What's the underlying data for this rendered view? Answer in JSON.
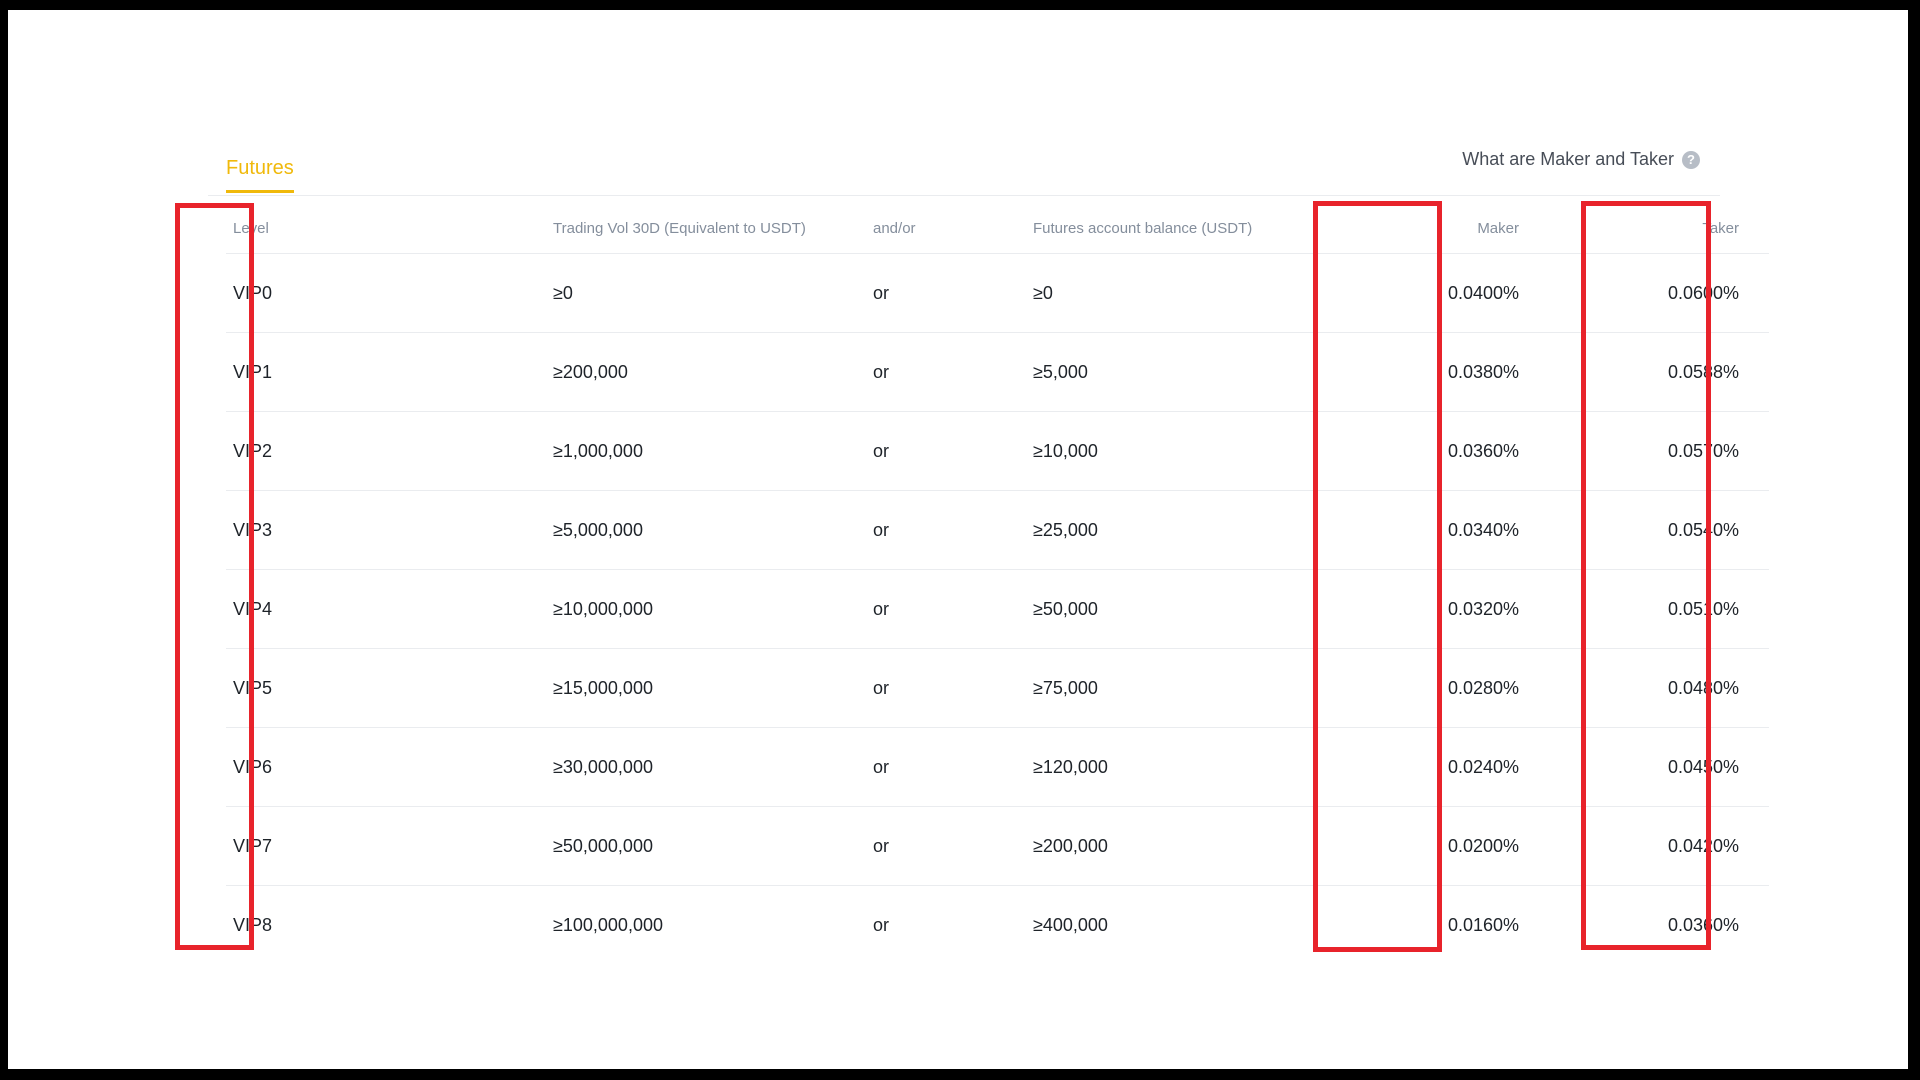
{
  "tabs": {
    "futures_label": "Futures"
  },
  "help": {
    "label": "What are Maker and Taker",
    "icon": "?"
  },
  "table": {
    "headers": {
      "level": "Level",
      "volume": "Trading Vol 30D (Equivalent to USDT)",
      "andor": "and/or",
      "balance": "Futures account balance (USDT)",
      "maker": "Maker",
      "taker": "Taker"
    },
    "rows": [
      {
        "level": "VIP0",
        "volume": "≥0",
        "andor": "or",
        "balance": "≥0",
        "maker": "0.0400%",
        "taker": "0.0600%"
      },
      {
        "level": "VIP1",
        "volume": "≥200,000",
        "andor": "or",
        "balance": "≥5,000",
        "maker": "0.0380%",
        "taker": "0.0588%"
      },
      {
        "level": "VIP2",
        "volume": "≥1,000,000",
        "andor": "or",
        "balance": "≥10,000",
        "maker": "0.0360%",
        "taker": "0.0570%"
      },
      {
        "level": "VIP3",
        "volume": "≥5,000,000",
        "andor": "or",
        "balance": "≥25,000",
        "maker": "0.0340%",
        "taker": "0.0540%"
      },
      {
        "level": "VIP4",
        "volume": "≥10,000,000",
        "andor": "or",
        "balance": "≥50,000",
        "maker": "0.0320%",
        "taker": "0.0510%"
      },
      {
        "level": "VIP5",
        "volume": "≥15,000,000",
        "andor": "or",
        "balance": "≥75,000",
        "maker": "0.0280%",
        "taker": "0.0480%"
      },
      {
        "level": "VIP6",
        "volume": "≥30,000,000",
        "andor": "or",
        "balance": "≥120,000",
        "maker": "0.0240%",
        "taker": "0.0450%"
      },
      {
        "level": "VIP7",
        "volume": "≥50,000,000",
        "andor": "or",
        "balance": "≥200,000",
        "maker": "0.0200%",
        "taker": "0.0420%"
      },
      {
        "level": "VIP8",
        "volume": "≥100,000,000",
        "andor": "or",
        "balance": "≥400,000",
        "maker": "0.0160%",
        "taker": "0.0360%"
      }
    ]
  },
  "colors": {
    "accent": "#f0b90b",
    "highlight": "#e8232b",
    "header_text": "#848e9c",
    "body_text": "#1e2329"
  }
}
